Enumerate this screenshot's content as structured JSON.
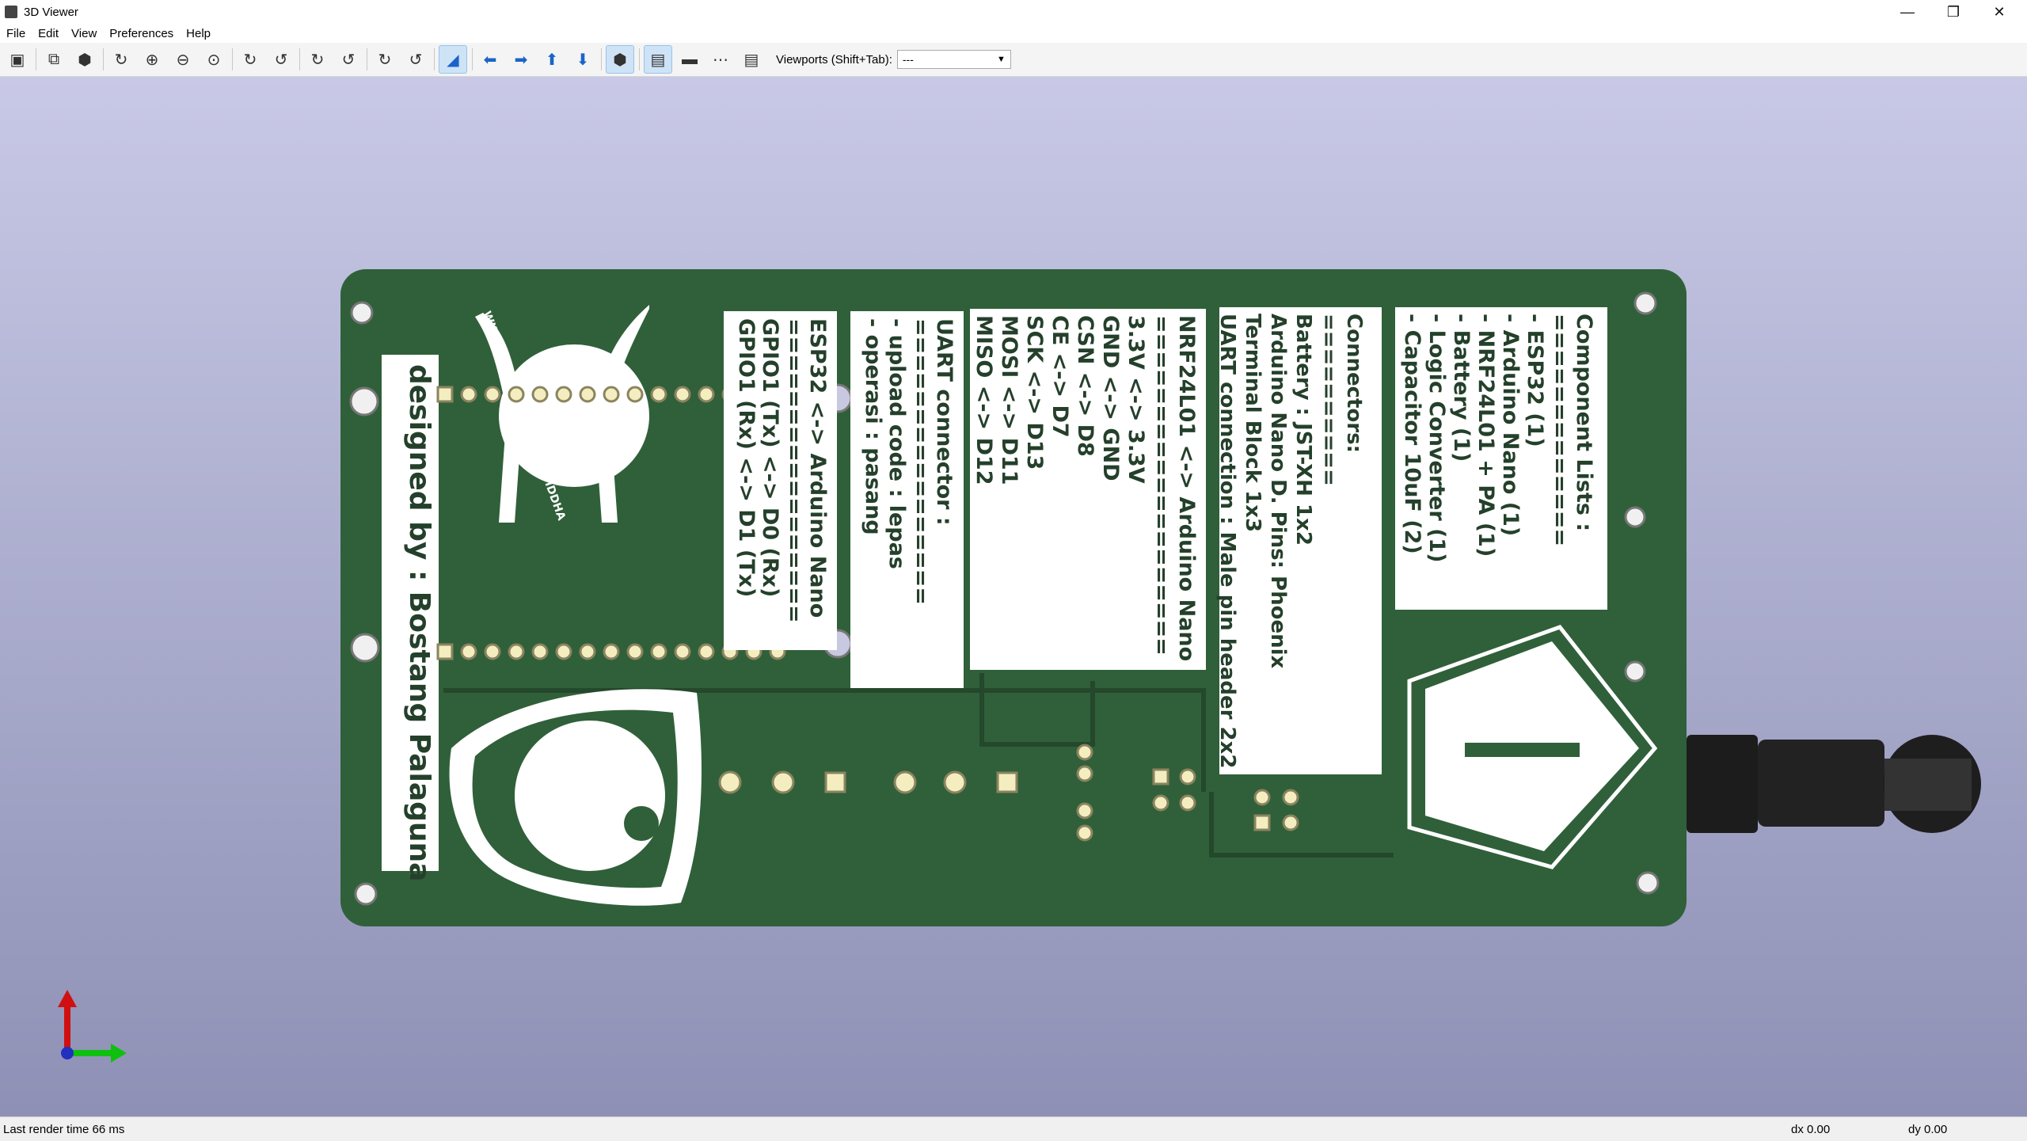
{
  "window": {
    "title": "3D Viewer"
  },
  "menu": {
    "file": "File",
    "edit": "Edit",
    "view": "View",
    "preferences": "Preferences",
    "help": "Help"
  },
  "toolbar": {
    "viewports_label": "Viewports (Shift+Tab):",
    "viewports_value": "---"
  },
  "board": {
    "credit": "designed by : Bostang Palaguna",
    "logo_text": "WIDYA CASTRENA DHARMA SIDDHA",
    "block_esp": [
      "ESP32 <-> Arduino Nano",
      "=================",
      "GPIO1 (Tx) <-> D0 (Rx)",
      "GPIO1 (Rx) <-> D1 (Tx)"
    ],
    "block_uart": [
      "UART connector :",
      "================",
      "- upload code : lepas",
      "- operasi : pasang"
    ],
    "block_nrf": [
      "NRF24L01 <-> Arduino Nano",
      "===================",
      "3.3V      <->      3.3V",
      "GND       <->      GND",
      "CSN       <->      D8",
      "CE         <->      D7",
      "SCK       <->      D13",
      "MOSI      <->      D11",
      "MISO      <->      D12"
    ],
    "block_conn": [
      "Connectors:",
      "==========",
      "Battery : JST-XH 1x2",
      "Arduino Nano D. Pins: Phoenix",
      "   Terminal Block 1x3",
      "UART connection : Male pin header 2x2"
    ],
    "block_comp": [
      "Component Lists :",
      "=============",
      "- ESP32                  (1)",
      "- Arduino Nano           (1)",
      "- NRF24L01 + PA         (1)",
      "- Battery                 (1)",
      "- Logic Converter        (1)",
      "- Capacitor 10uF         (2)"
    ]
  },
  "status": {
    "render_time": "Last render time 66 ms",
    "dx": "dx 0.00",
    "dy": "dy 0.00"
  },
  "colors": {
    "board": "#30603a",
    "silkscreen": "#ffffff",
    "pad": "#f3edc0"
  }
}
